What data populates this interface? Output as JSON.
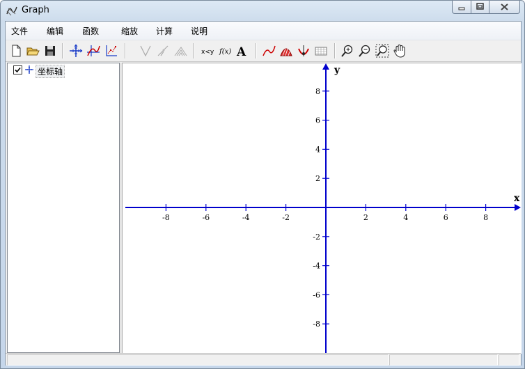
{
  "window": {
    "title": "Graph"
  },
  "menu": [
    "文件",
    "编辑",
    "函数",
    "缩放",
    "计算",
    "说明"
  ],
  "toolbar": {
    "buttons": [
      {
        "name": "new-file-icon"
      },
      {
        "name": "open-folder-icon"
      },
      {
        "name": "save-disk-icon"
      },
      {
        "name": "axes-icon"
      },
      {
        "name": "insert-function-icon"
      },
      {
        "name": "insert-point-series-icon"
      },
      {
        "name": "tangent-icon"
      },
      {
        "name": "shading-icon"
      },
      {
        "name": "relation-icon"
      },
      {
        "name": "inequality-icon",
        "label": "x<y"
      },
      {
        "name": "insert-label-icon",
        "label": "f(x)"
      },
      {
        "name": "text-icon",
        "label": "A"
      },
      {
        "name": "trend-line-icon"
      },
      {
        "name": "area-icon"
      },
      {
        "name": "evaluate-icon"
      },
      {
        "name": "table-icon"
      },
      {
        "name": "zoom-in-icon"
      },
      {
        "name": "zoom-out-icon"
      },
      {
        "name": "zoom-square-icon"
      },
      {
        "name": "hand-pan-icon"
      }
    ]
  },
  "tree": {
    "items": [
      {
        "label": "坐标轴",
        "checked": true
      }
    ]
  },
  "graph": {
    "x_axis_label": "x",
    "y_axis_label": "y",
    "x_range": [
      -10,
      10
    ],
    "y_range": [
      -10,
      8
    ],
    "x_ticks": [
      -8,
      -6,
      -4,
      -2,
      2,
      4,
      6,
      8
    ],
    "y_ticks": [
      8,
      6,
      4,
      2,
      -2,
      -4,
      -6,
      -8
    ],
    "axis_color": "#0000cc"
  },
  "status": {
    "panes": [
      "",
      "",
      ""
    ]
  }
}
